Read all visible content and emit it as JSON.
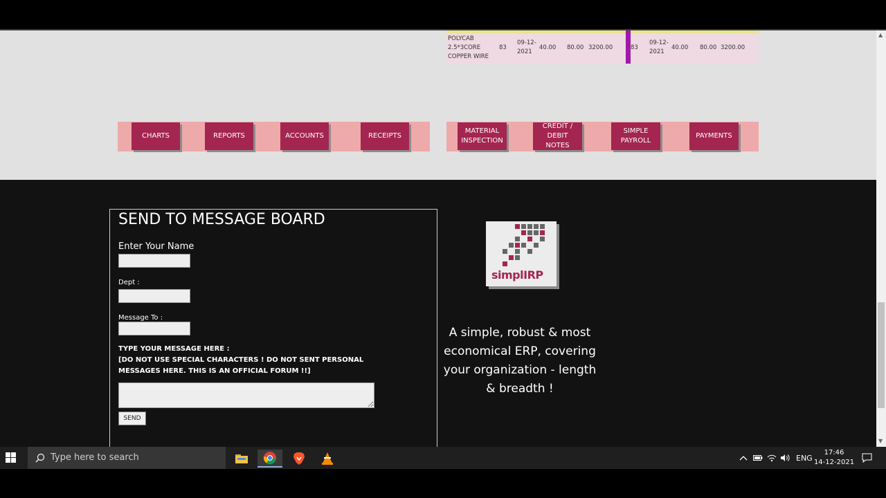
{
  "table_row": {
    "material": [
      "POLYCAB",
      "2.5*3CORE",
      "COPPER WIRE"
    ],
    "left": {
      "code": "83",
      "date": [
        "09-12-",
        "2021"
      ],
      "qty": "40.00",
      "rate": "80.00",
      "amount": "3200.00"
    },
    "right": {
      "code": "83",
      "date": [
        "09-12-",
        "2021"
      ],
      "qty": "40.00",
      "rate": "80.00",
      "amount": "3200.00"
    }
  },
  "nav_left": [
    "CHARTS",
    "REPORTS",
    "ACCOUNTS",
    "RECEIPTS"
  ],
  "nav_right": [
    [
      "MATERIAL",
      "INSPECTION"
    ],
    [
      "CREDIT / DEBIT",
      "NOTES"
    ],
    [
      "SIMPLE",
      "PAYROLL"
    ],
    [
      "PAYMENTS"
    ]
  ],
  "message_board": {
    "title": "SEND TO MESSAGE BOARD",
    "name_label": "Enter Your Name",
    "dept_label": "Dept :",
    "to_label": "Message To :",
    "message_label": "TYPE YOUR MESSAGE HERE :",
    "warning_1": "[DO NOT USE SPECIAL CHARACTERS ! DO NOT SENT PERSONAL",
    "warning_2": "MESSAGES HERE. THIS IS AN OFFICIAL FORUM !!]",
    "send_label": "SEND"
  },
  "logo_text": "simplIRP",
  "tagline": [
    "A simple, robust & most",
    "economical ERP, covering",
    "your organization - length",
    "& breadth !"
  ],
  "taskbar": {
    "search_placeholder": "Type here to search",
    "lang": "ENG",
    "time": "17:46",
    "date": "14-12-2021"
  },
  "colors": {
    "button": "#a32550",
    "bar": "#eea9aa",
    "accent": "#a01aa8"
  }
}
